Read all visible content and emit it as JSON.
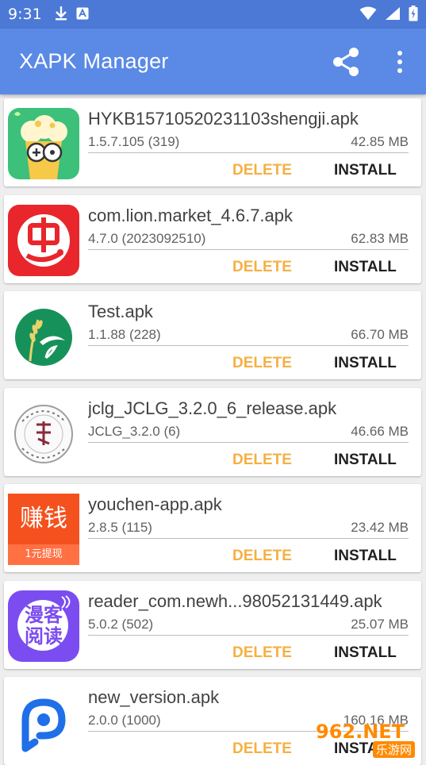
{
  "status_bar": {
    "time": "9:31"
  },
  "app_bar": {
    "title": "XAPK Manager"
  },
  "colors": {
    "primary": "#5a8ae6",
    "status_bar": "#4c79d6",
    "delete": "#f5b043",
    "install": "#212121"
  },
  "apks": [
    {
      "name": "HYKB15710520231103shengji.apk",
      "version": "1.5.7.105 (319)",
      "size": "42.85 MB",
      "delete": "DELETE",
      "install": "INSTALL",
      "icon": "popcorn-game-icon"
    },
    {
      "name": "com.lion.market_4.6.7.apk",
      "version": "4.7.0 (2023092510)",
      "size": "62.83 MB",
      "delete": "DELETE",
      "install": "INSTALL",
      "icon": "worm-red-icon"
    },
    {
      "name": "Test.apk",
      "version": "1.1.88 (228)",
      "size": "66.70 MB",
      "delete": "DELETE",
      "install": "INSTALL",
      "icon": "green-wheat-icon"
    },
    {
      "name": "jclg_JCLG_3.2.0_6_release.apk",
      "version": "JCLG_3.2.0 (6)",
      "size": "46.66 MB",
      "delete": "DELETE",
      "install": "INSTALL",
      "icon": "university-seal-icon"
    },
    {
      "name": "youchen-app.apk",
      "version": "2.8.5 (115)",
      "size": "23.42 MB",
      "delete": "DELETE",
      "install": "INSTALL",
      "icon": "earn-money-icon",
      "icon_text": "赚钱",
      "icon_subtext": "1元提现"
    },
    {
      "name": "reader_com.newh...98052131449.apk",
      "version": "5.0.2 (502)",
      "size": "25.07 MB",
      "delete": "DELETE",
      "install": "INSTALL",
      "icon": "comic-reader-icon",
      "icon_text_1": "漫客",
      "icon_text_2": "阅读"
    },
    {
      "name": "new_version.apk",
      "version": "2.0.0 (1000)",
      "size": "160.16 MB",
      "delete": "DELETE",
      "install": "INSTALL",
      "icon": "blue-pin-icon"
    }
  ],
  "watermark": {
    "text_1": "962.NET",
    "text_2": "乐游网"
  }
}
